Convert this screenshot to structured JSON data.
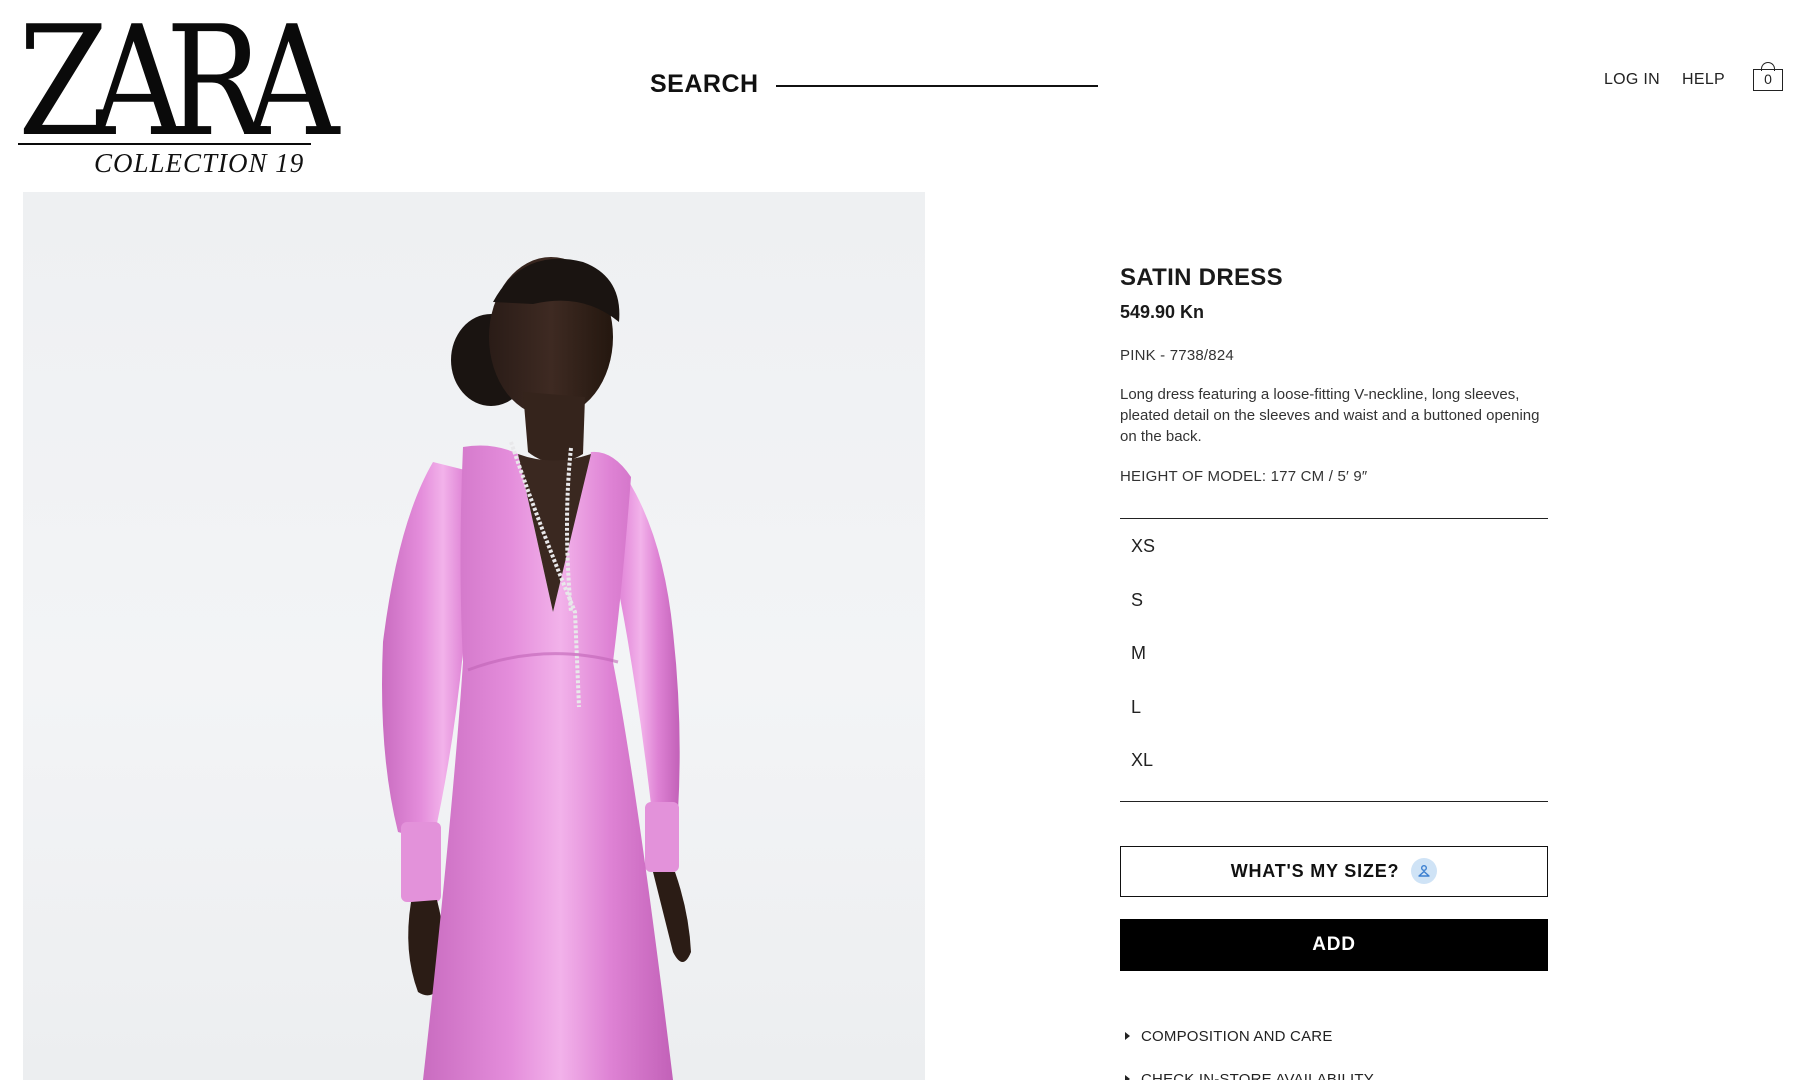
{
  "header": {
    "logo_text": "ZARA",
    "logo_sub": "COLLECTION 19",
    "search_label": "SEARCH",
    "login_label": "LOG IN",
    "help_label": "HELP",
    "bag_count": "0",
    "icons": {
      "bag": "shopping-bag-icon"
    }
  },
  "product": {
    "title": "SATIN DRESS",
    "price": "549.90 Kn",
    "color_ref": "PINK - 7738/824",
    "description": "Long dress featuring a loose-fitting V-neckline, long sleeves, pleated detail on the sleeves and waist and a buttoned opening on the back.",
    "model_height": "HEIGHT OF MODEL: 177 CM / 5′ 9″",
    "dress_color": "#e07fd6",
    "background_color": "#eef0f2"
  },
  "sizes": [
    "XS",
    "S",
    "M",
    "L",
    "XL"
  ],
  "actions": {
    "whats_my_size_label": "WHAT'S MY SIZE?",
    "add_label": "ADD",
    "size_icon": "hanger-person-icon"
  },
  "accordions": [
    "COMPOSITION AND CARE",
    "CHECK IN-STORE AVAILABILITY"
  ]
}
